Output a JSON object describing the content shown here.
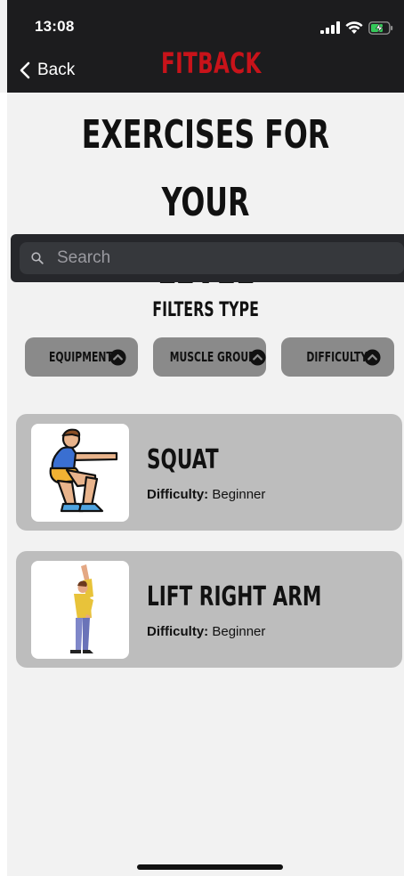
{
  "status_bar": {
    "time": "13:08"
  },
  "header": {
    "back_label": "Back",
    "brand": "FITBACK"
  },
  "page": {
    "title_line1": "EXERCISES FOR YOUR",
    "title_line2": "LEVEL"
  },
  "search": {
    "placeholder": "Search",
    "value": ""
  },
  "filters": {
    "label": "FILTERS TYPE",
    "chips": [
      {
        "label": "EQUIPMENT",
        "icon": "chevron-up-circle-icon"
      },
      {
        "label": "MUSCLE GROUP",
        "icon": "chevron-up-circle-icon"
      },
      {
        "label": "DIFFICULTY",
        "icon": "chevron-up-circle-icon"
      }
    ]
  },
  "exercises": [
    {
      "name": "SQUAT",
      "difficulty_label": "Difficulty:",
      "difficulty": "Beginner",
      "icon": "squat-figure-icon"
    },
    {
      "name": "LIFT RIGHT ARM",
      "difficulty_label": "Difficulty:",
      "difficulty": "Beginner",
      "icon": "arm-raise-figure-icon"
    }
  ],
  "colors": {
    "brand": "#c8131a",
    "header_bg": "#1c1c1e",
    "card_bg": "#bdbdbd",
    "chip_bg": "#8a8a8a",
    "page_bg": "#f2f2f2"
  }
}
